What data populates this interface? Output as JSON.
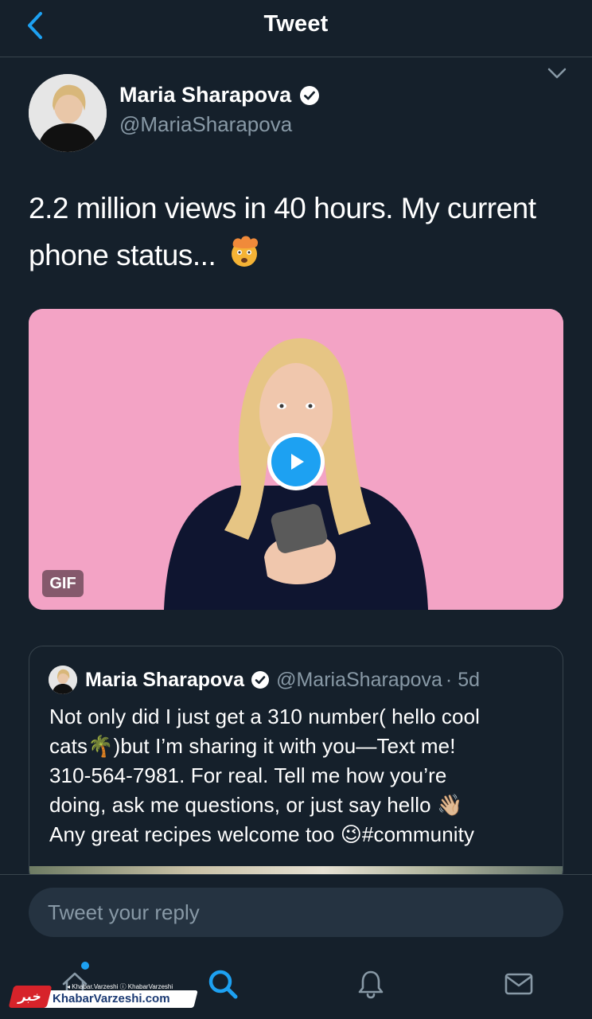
{
  "header": {
    "title": "Tweet",
    "back_icon": "chevron-left-icon"
  },
  "tweet": {
    "author": {
      "name": "Maria Sharapova",
      "handle": "@MariaSharapova",
      "verified": true
    },
    "text": "2.2 million views in 40 hours. My current phone status...",
    "emoji": "exploding-head",
    "media": {
      "type": "GIF",
      "badge": "GIF",
      "icon": "play-icon"
    }
  },
  "quote": {
    "author": {
      "name": "Maria Sharapova",
      "handle": "@MariaSharapova",
      "verified": true
    },
    "time": "· 5d",
    "lines": [
      "Not only did I just get a 310 number( hello cool",
      "cats🌴)but I’m sharing it with you—Text me!",
      "310-564-7981. For real. Tell me how you’re",
      "doing, ask me questions, or just say hello 👋🏼",
      "Any great recipes welcome too 😉#community"
    ]
  },
  "reply": {
    "placeholder": "Tweet your reply"
  },
  "tabbar": {
    "items": [
      "home-icon",
      "search-icon",
      "notifications-icon",
      "messages-icon"
    ],
    "active": "search-icon"
  },
  "watermark": {
    "top": "◂ Khabar.Varzeshi  ⓘ KhabarVarzeshi",
    "text": "KhabarVarzeshi.com",
    "logo": "خبر"
  },
  "colors": {
    "background": "#15202b",
    "accent": "#1da1f2",
    "secondary_text": "#8899a6",
    "border": "#38444d"
  }
}
